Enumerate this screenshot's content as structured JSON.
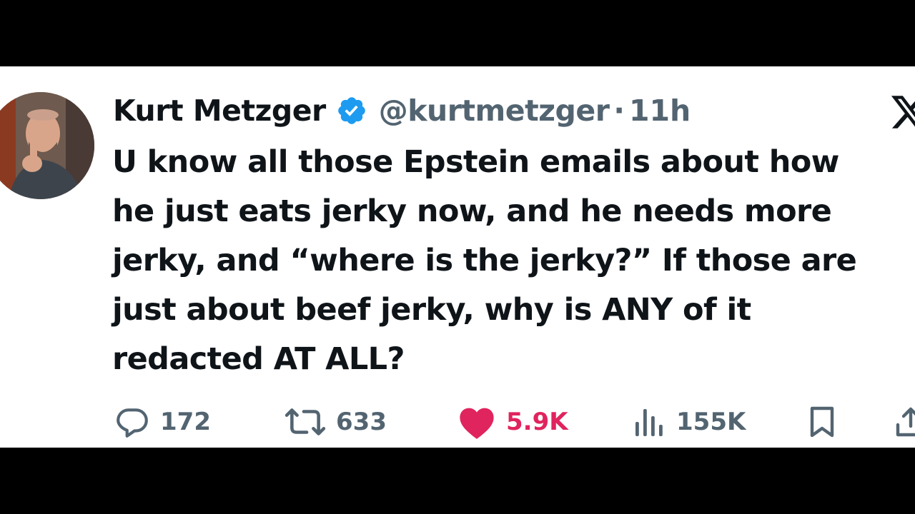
{
  "tweet": {
    "author": {
      "display_name": "Kurt Metzger",
      "handle": "@kurtmetzger",
      "verified": true
    },
    "separator": "·",
    "time": "11h",
    "text_lines": [
      "U know all those Epstein emails about how",
      "he just eats jerky now, and he needs more",
      "jerky, and “where is the jerky?” If those are",
      "just about beef jerky, why is ANY of it",
      "redacted AT ALL?"
    ],
    "actions": {
      "reply_count": "172",
      "repost_count": "633",
      "like_count": "5.9K",
      "views_count": "155K"
    }
  },
  "colors": {
    "background": "#000000",
    "card": "#ffffff",
    "text_primary": "#0f1419",
    "text_secondary": "#536471",
    "verified_blue": "#1d9bf0",
    "like_pink": "#e0245e"
  },
  "icons": {
    "platform_logo": "x-logo-icon",
    "verified": "verified-badge-icon",
    "reply": "reply-icon",
    "repost": "repost-icon",
    "like": "heart-icon",
    "views": "views-icon",
    "bookmark": "bookmark-icon",
    "share": "share-icon"
  }
}
